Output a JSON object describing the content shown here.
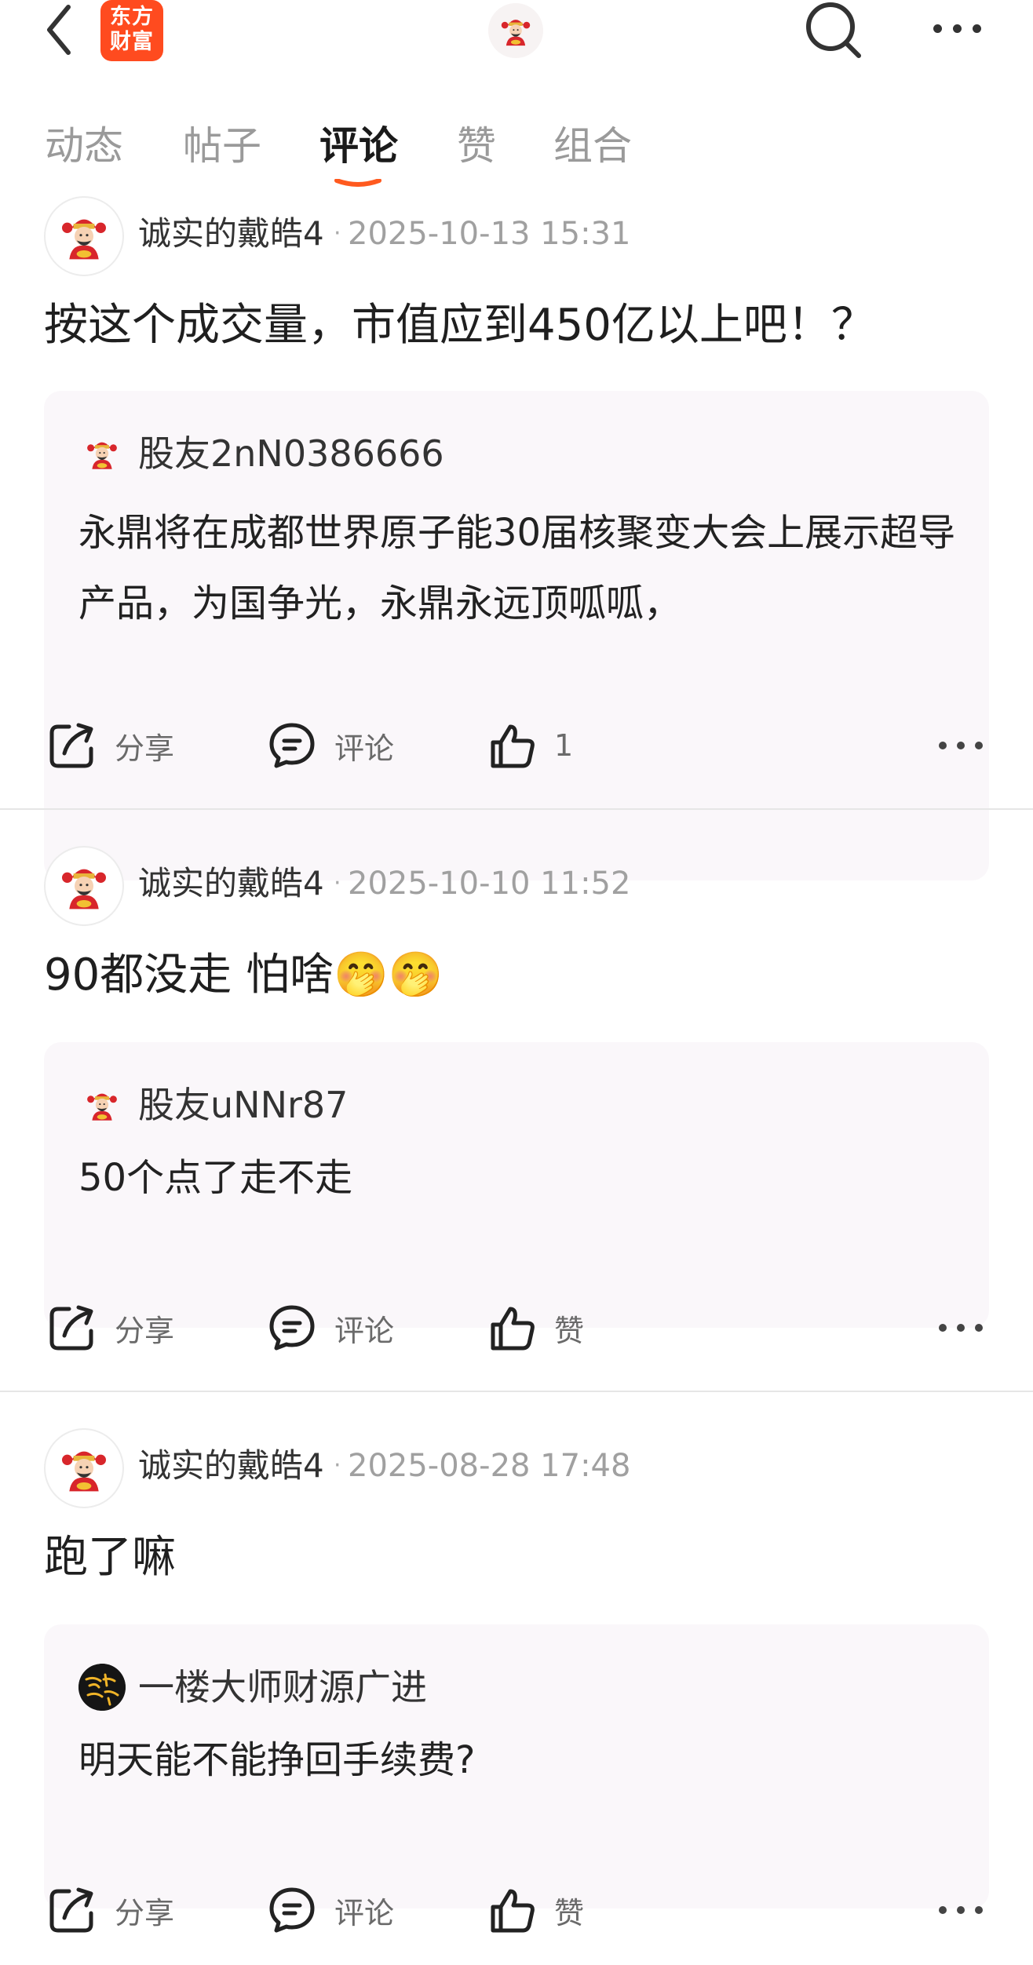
{
  "header": {
    "logo_line1": "东方",
    "logo_line2": "财富"
  },
  "tabs": [
    {
      "label": "动态"
    },
    {
      "label": "帖子"
    },
    {
      "label": "评论"
    },
    {
      "label": "赞"
    },
    {
      "label": "组合"
    }
  ],
  "active_tab": "评论",
  "colors": {
    "brand": "#ff4b1f",
    "tab_underline": "#ff5a1f"
  },
  "posts": [
    {
      "author": "诚实的戴皓4",
      "dot": "·",
      "time": "2025-10-13 15:31",
      "text": "按这个成交量，市值应到450亿以上吧！？",
      "quote_user": "股友2nN0386666",
      "quote_text": "永鼎将在成都世界原子能30届核聚变大会上展示超导产品，为国争光，永鼎永远顶呱呱，",
      "share": "分享",
      "comment": "评论",
      "like": "1"
    },
    {
      "author": "诚实的戴皓4",
      "dot": "·",
      "time": "2025-10-10 11:52",
      "text": "90都没走 怕啥🤭🤭",
      "quote_user": "股友uNNr87",
      "quote_text": "50个点了走不走",
      "share": "分享",
      "comment": "评论",
      "like": "赞"
    },
    {
      "author": "诚实的戴皓4",
      "dot": "·",
      "time": "2025-08-28 17:48",
      "text": "跑了嘛",
      "quote_user": "一楼大师财源广进",
      "quote_text": "明天能不能挣回手续费?",
      "share": "分享",
      "comment": "评论",
      "like": "赞"
    }
  ]
}
